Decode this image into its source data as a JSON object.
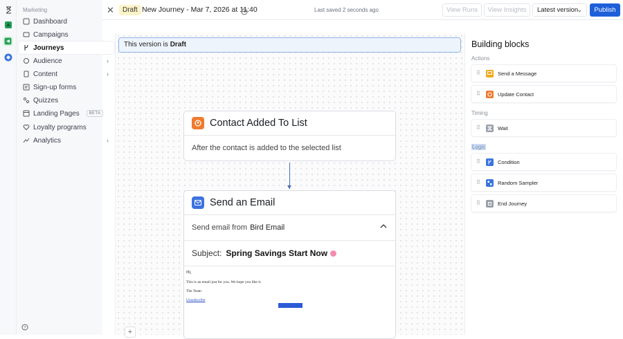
{
  "colors": {
    "accent": "#1e5fd9",
    "draft": "#fdf3c8",
    "orange": "#f07a2e",
    "blue": "#3b73e0",
    "gray": "#9aa0aa"
  },
  "sidebar": {
    "section": "Marketing",
    "items": [
      {
        "label": "Dashboard",
        "icon": "dashboard-icon"
      },
      {
        "label": "Campaigns",
        "icon": "campaigns-icon"
      },
      {
        "label": "Journeys",
        "icon": "journeys-icon",
        "active": true
      },
      {
        "label": "Audience",
        "icon": "audience-icon",
        "chevron": true
      },
      {
        "label": "Content",
        "icon": "content-icon",
        "chevron": true
      },
      {
        "label": "Sign-up forms",
        "icon": "forms-icon"
      },
      {
        "label": "Quizzes",
        "icon": "quizzes-icon"
      },
      {
        "label": "Landing Pages",
        "icon": "pages-icon",
        "badge": "BETA"
      },
      {
        "label": "Loyalty programs",
        "icon": "heart-icon"
      },
      {
        "label": "Analytics",
        "icon": "analytics-icon",
        "chevron": true
      }
    ]
  },
  "topbar": {
    "status": "Draft",
    "title": "New Journey - Mar 7, 2026 at 11:40",
    "saved": "Last saved 2 seconds ago",
    "view_runs": "View Runs",
    "view_insights": "View Insights",
    "version": "Latest version",
    "publish": "Publish"
  },
  "banner": {
    "prefix": "This version is",
    "status": "Draft"
  },
  "trigger": {
    "title": "Contact Added To List",
    "description": "After the contact is added to the selected list"
  },
  "email_step": {
    "title": "Send an Email",
    "from_prefix": "Send email from",
    "from_name": "Bird Email",
    "subject_label": "Subject:",
    "subject": "Spring Savings Start Now",
    "body": {
      "greeting": "Hi,",
      "line1": "This is an email just for you. We hope you like it.",
      "signoff": "The Team",
      "unsubscribe": "Unsubscribe"
    }
  },
  "panel": {
    "title": "Building blocks",
    "groups": {
      "actions": "Actions",
      "timing": "Timing",
      "logic": "Logic"
    },
    "blocks": {
      "send_message": "Send a Message",
      "update_contact": "Update Contact",
      "wait": "Wait",
      "condition": "Condition",
      "random_sampler": "Random Sampler",
      "end_journey": "End Journey"
    }
  }
}
